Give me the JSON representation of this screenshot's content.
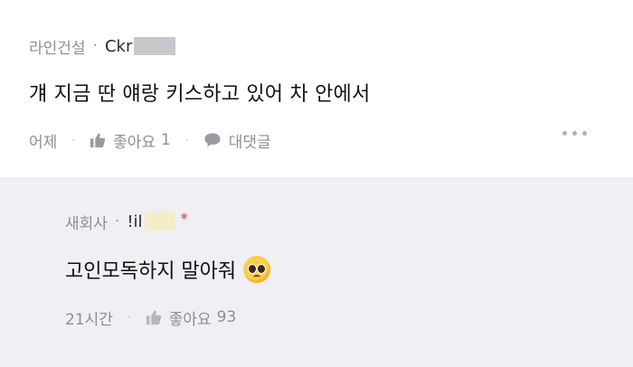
{
  "comment": {
    "company": "라인건설",
    "separator": "·",
    "handle": "Ckr",
    "text": "걔 지금 딴 얘랑 키스하고 있어 차 안에서",
    "time": "어제",
    "like_label": "좋아요",
    "like_count": "1",
    "reply_label": "대댓글",
    "action_separator": "·"
  },
  "reply": {
    "company": "새회사",
    "separator": "·",
    "handle": "!il",
    "author_marker": "*",
    "text": "고인모독하지 말아줘",
    "time": "21시간",
    "like_label": "좋아요",
    "like_count": "93",
    "action_separator": "·"
  },
  "colors": {
    "reply_background": "#efeff4",
    "meta_text": "#8e8e93",
    "author_marker": "#e0292e"
  },
  "icons": [
    "thumbs-up-icon",
    "speech-bubble-icon",
    "more-dots-icon",
    "pleading-face-emoji"
  ]
}
